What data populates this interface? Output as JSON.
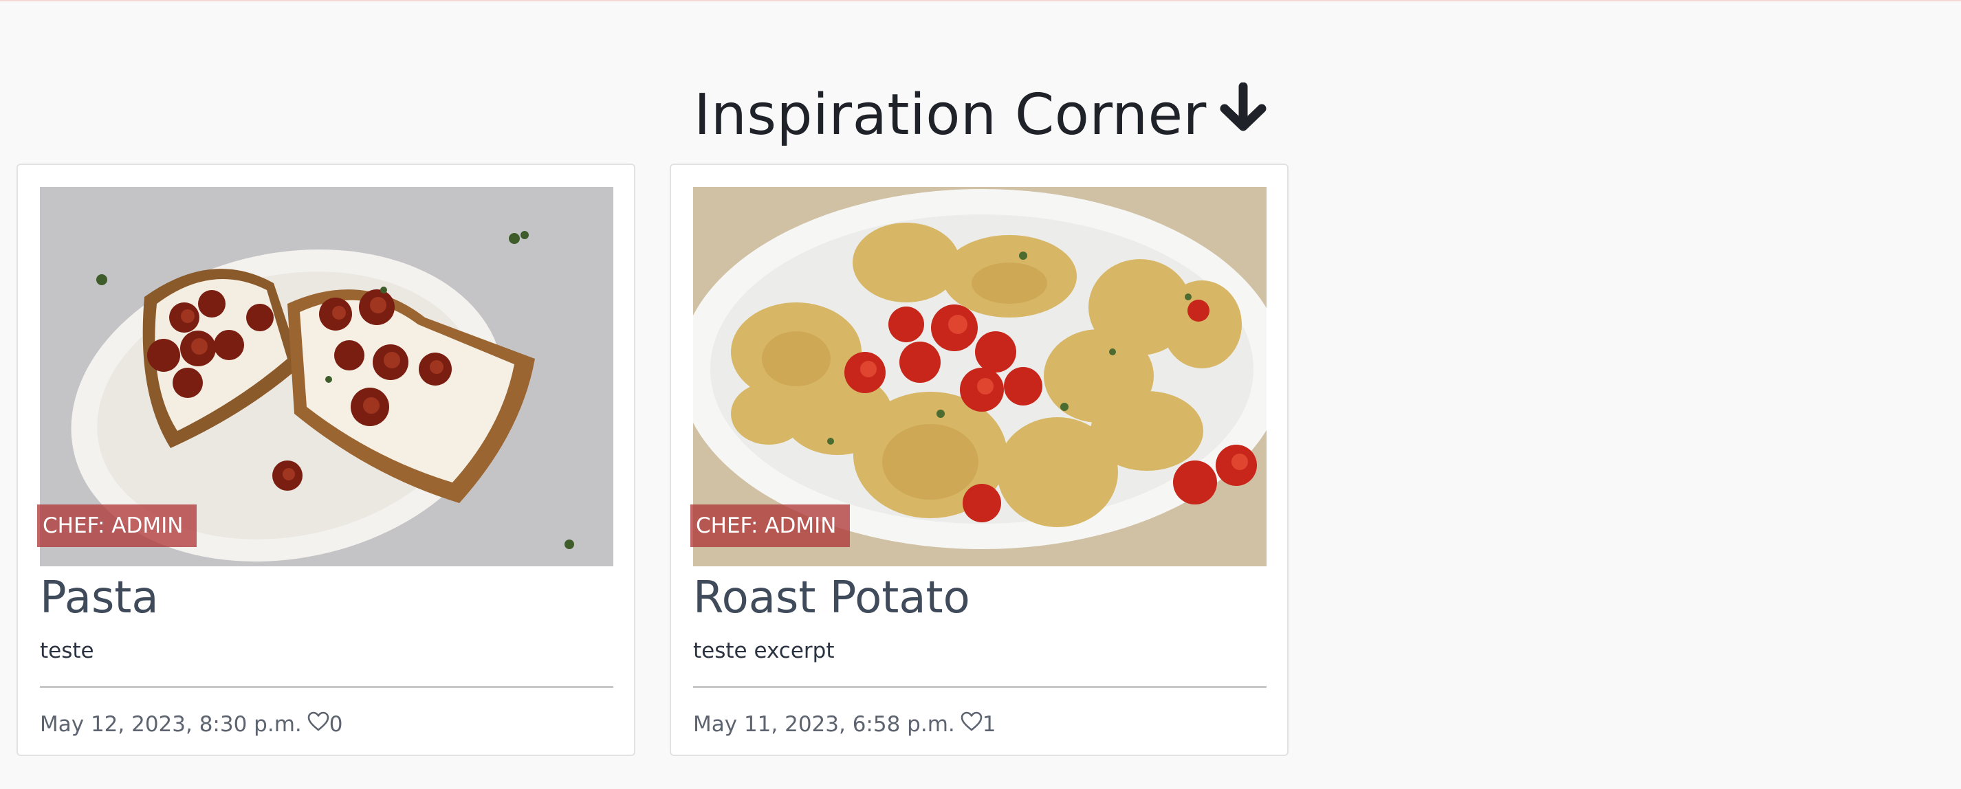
{
  "page": {
    "heading": "Inspiration Corner",
    "heading_icon": "arrow-down-icon"
  },
  "colors": {
    "background": "#f9f9f9",
    "heading_text": "#1f2329",
    "title_text": "#3f4a5a",
    "badge_bg": "#b03a3a"
  },
  "cards": [
    {
      "badge": "CHEF: ADMIN",
      "title": "Pasta",
      "excerpt": "teste",
      "date": "May 12, 2023, 8:30 p.m.",
      "likes": "0",
      "image": "bruschetta-toast-photo"
    },
    {
      "badge": "CHEF: ADMIN",
      "title": "Roast Potato",
      "excerpt": "teste excerpt",
      "date": "May 11, 2023, 6:58 p.m.",
      "likes": "1",
      "image": "roast-potatoes-photo"
    }
  ]
}
